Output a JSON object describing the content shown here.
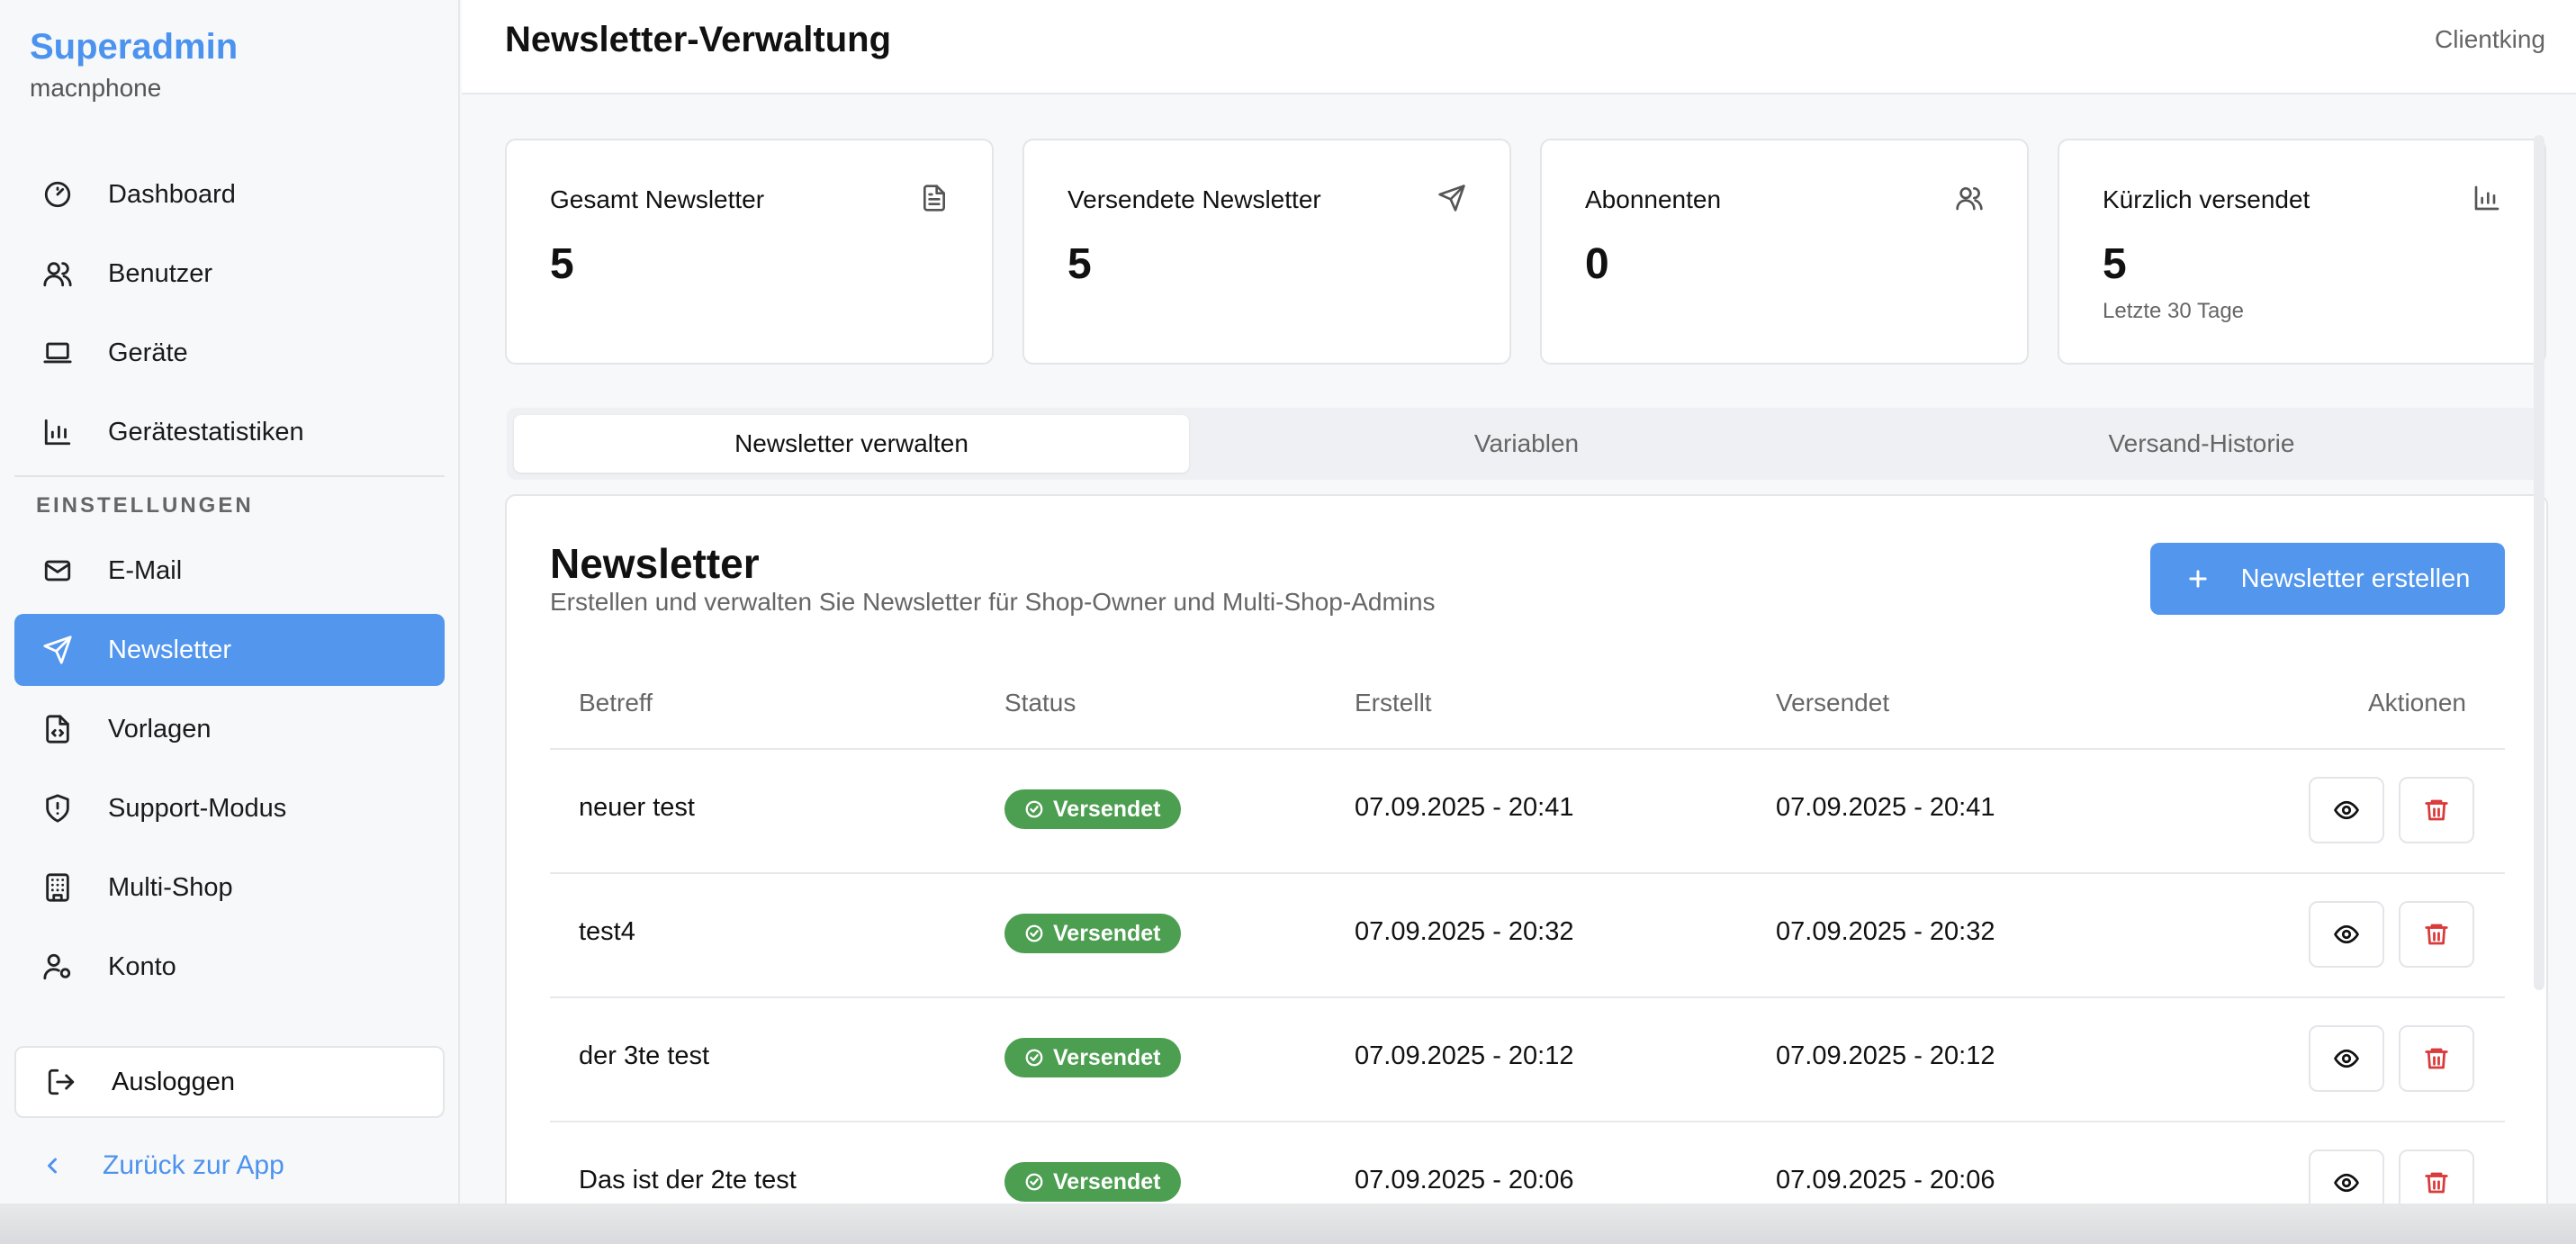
{
  "sidebar": {
    "brand_title": "Superadmin",
    "brand_sub": "macnphone",
    "items": [
      {
        "label": "Dashboard",
        "icon": "gauge-icon"
      },
      {
        "label": "Benutzer",
        "icon": "users-icon"
      },
      {
        "label": "Geräte",
        "icon": "laptop-icon"
      },
      {
        "label": "Gerätestatistiken",
        "icon": "bar-chart-icon"
      }
    ],
    "section_label": "EINSTELLUNGEN",
    "settings_items": [
      {
        "label": "E-Mail",
        "icon": "mail-icon"
      },
      {
        "label": "Newsletter",
        "icon": "send-icon",
        "active": true
      },
      {
        "label": "Vorlagen",
        "icon": "file-code-icon"
      },
      {
        "label": "Support-Modus",
        "icon": "shield-icon"
      },
      {
        "label": "Multi-Shop",
        "icon": "building-icon"
      },
      {
        "label": "Konto",
        "icon": "user-cog-icon"
      }
    ],
    "logout_label": "Ausloggen",
    "back_label": "Zurück zur App"
  },
  "header": {
    "title": "Newsletter-Verwaltung",
    "right_text": "Clientking"
  },
  "stats": [
    {
      "label": "Gesamt Newsletter",
      "value": "5",
      "sub": "",
      "icon": "file-text-icon"
    },
    {
      "label": "Versendete Newsletter",
      "value": "5",
      "sub": "",
      "icon": "send-icon"
    },
    {
      "label": "Abonnenten",
      "value": "0",
      "sub": "",
      "icon": "users-icon"
    },
    {
      "label": "Kürzlich versendet",
      "value": "5",
      "sub": "Letzte 30 Tage",
      "icon": "bar-chart-icon"
    }
  ],
  "tabs": [
    "Newsletter verwalten",
    "Variablen",
    "Versand-Historie"
  ],
  "panel": {
    "title": "Newsletter",
    "subtitle": "Erstellen und verwalten Sie Newsletter für Shop-Owner und Multi-Shop-Admins",
    "create_label": "Newsletter erstellen"
  },
  "table": {
    "headers": [
      "Betreff",
      "Status",
      "Erstellt",
      "Versendet",
      "Aktionen"
    ],
    "rows": [
      {
        "subject": "neuer test",
        "status": "Versendet",
        "created": "07.09.2025 - 20:41",
        "sent": "07.09.2025 - 20:41"
      },
      {
        "subject": "test4",
        "status": "Versendet",
        "created": "07.09.2025 - 20:32",
        "sent": "07.09.2025 - 20:32"
      },
      {
        "subject": "der 3te test",
        "status": "Versendet",
        "created": "07.09.2025 - 20:12",
        "sent": "07.09.2025 - 20:12"
      },
      {
        "subject": "Das ist der 2te test",
        "status": "Versendet",
        "created": "07.09.2025 - 20:06",
        "sent": "07.09.2025 - 20:06"
      }
    ]
  },
  "colors": {
    "accent": "#5296ee",
    "success": "#4c9e50",
    "danger": "#d93a3a"
  }
}
